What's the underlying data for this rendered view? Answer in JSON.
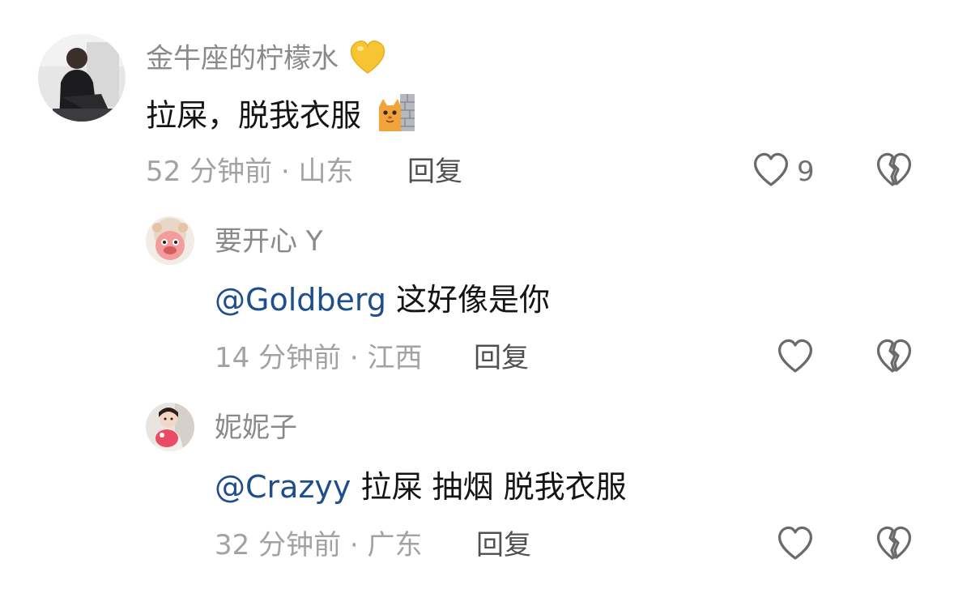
{
  "comments": [
    {
      "username": "金牛座的柠檬水",
      "username_icon": "yellow-heart-icon",
      "text": "拉屎，脱我衣服",
      "text_icon": "cat-behind-wall-icon",
      "time": "52 分钟前",
      "location": "山东",
      "separator": "·",
      "reply_label": "回复",
      "likes": "9"
    },
    {
      "username": "要开心 Y",
      "mention": "@Goldberg",
      "text": " 这好像是你",
      "time": "14 分钟前",
      "location": "江西",
      "separator": "·",
      "reply_label": "回复"
    },
    {
      "username": "妮妮子",
      "mention": "@Crazyy",
      "text": " 拉屎 抽烟 脱我衣服",
      "time": "32 分钟前",
      "location": "广东",
      "separator": "·",
      "reply_label": "回复"
    }
  ],
  "colors": {
    "username": "#8a8a8a",
    "meta": "#a2a2a2",
    "mention": "#1f4e8c",
    "text": "#141414",
    "icon_stroke": "#6a6a6a"
  }
}
